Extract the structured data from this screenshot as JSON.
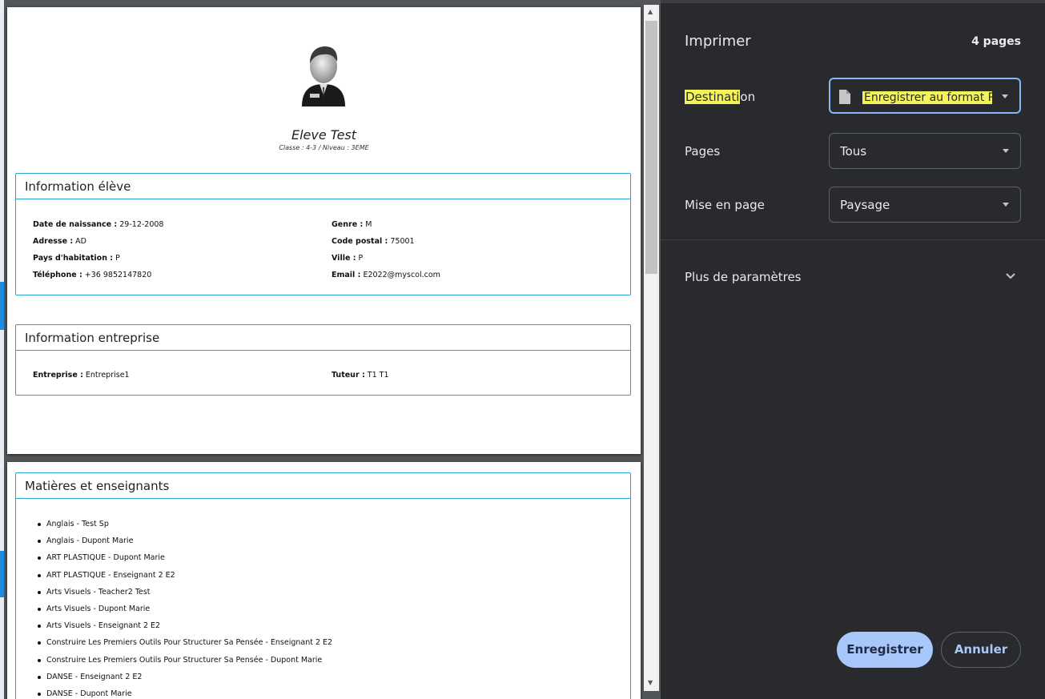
{
  "panel": {
    "title": "Imprimer",
    "page_count": "4 pages",
    "destination_label_hl": "Destinati",
    "destination_label_rest": "on",
    "destination_value": "Enregistrer au format PDF",
    "pages_label": "Pages",
    "pages_value": "Tous",
    "layout_label": "Mise en page",
    "layout_value": "Paysage",
    "more_settings": "Plus de paramètres",
    "save_button": "Enregistrer",
    "cancel_button": "Annuler",
    "icons": [
      "file-icon",
      "caret-down-icon",
      "chevron-down-icon"
    ]
  },
  "page1": {
    "student_name": "Eleve Test",
    "student_sub": "Classe : 4-3 / Niveau : 3EME",
    "eleve_card": {
      "title": "Information élève",
      "fields": [
        {
          "label": "Date de naissance :",
          "value": " 29-12-2008"
        },
        {
          "label": "Genre :",
          "value": " M"
        },
        {
          "label": "Adresse :",
          "value": " AD"
        },
        {
          "label": "Code postal :",
          "value": " 75001"
        },
        {
          "label": "Pays d'habitation :",
          "value": " P"
        },
        {
          "label": "Ville :",
          "value": " P"
        },
        {
          "label": "Téléphone :",
          "value": " +36 9852147820"
        },
        {
          "label": "Email :",
          "value": " E2022@myscol.com"
        }
      ]
    },
    "entreprise_card": {
      "title": "Information entreprise",
      "fields": [
        {
          "label": "Entreprise :",
          "value": " Entreprise1"
        },
        {
          "label": "Tuteur :",
          "value": " T1 T1"
        }
      ]
    }
  },
  "page2": {
    "matieres_card": {
      "title": "Matières et enseignants",
      "subjects": [
        "Anglais - Test Sp",
        "Anglais - Dupont Marie",
        "ART PLASTIQUE - Dupont Marie",
        "ART PLASTIQUE - Enseignant 2 E2",
        "Arts Visuels - Teacher2 Test",
        "Arts Visuels - Dupont Marie",
        "Arts Visuels - Enseignant 2 E2",
        "Construire Les Premiers Outils Pour Structurer Sa Pensée - Enseignant 2 E2",
        "Construire Les Premiers Outils Pour Structurer Sa Pensée - Dupont Marie",
        "DANSE - Enseignant 2 E2",
        "DANSE - Dupont Marie"
      ]
    }
  }
}
